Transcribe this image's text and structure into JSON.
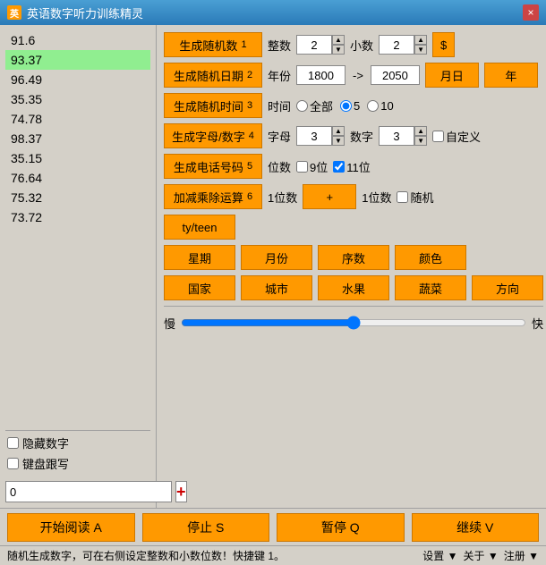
{
  "window": {
    "title": "英语数字听力训练精灵",
    "close_label": "×"
  },
  "number_list": {
    "items": [
      {
        "value": "91.6",
        "selected": false
      },
      {
        "value": "93.37",
        "selected": true
      },
      {
        "value": "96.49",
        "selected": false
      },
      {
        "value": "35.35",
        "selected": false
      },
      {
        "value": "74.78",
        "selected": false
      },
      {
        "value": "98.37",
        "selected": false
      },
      {
        "value": "35.15",
        "selected": false
      },
      {
        "value": "76.64",
        "selected": false
      },
      {
        "value": "75.32",
        "selected": false
      },
      {
        "value": "73.72",
        "selected": false
      }
    ],
    "hide_numbers_label": "隐藏数字",
    "keyboard_follow_label": "键盘跟写",
    "input_value": "0",
    "add_icon": "+"
  },
  "controls": {
    "row1": {
      "btn_label": "生成随机数",
      "btn_num": "1",
      "integer_label": "整数",
      "integer_value": "2",
      "decimal_label": "小数",
      "decimal_value": "2",
      "currency_label": "$"
    },
    "row2": {
      "btn_label": "生成随机日期",
      "btn_num": "2",
      "year_label": "年份",
      "year_from": "1800",
      "arrow": "->",
      "year_to": "2050",
      "month_label": "月日",
      "year_unit": "年"
    },
    "row3": {
      "btn_label": "生成随机时间",
      "btn_num": "3",
      "time_label": "时间",
      "radio_all": "全部",
      "radio_5": "5",
      "radio_10": "10"
    },
    "row4": {
      "btn_label": "生成字母/数字",
      "btn_num": "4",
      "letter_label": "字母",
      "letter_value": "3",
      "number_label": "数字",
      "number_value": "3",
      "custom_label": "自定义"
    },
    "row5": {
      "btn_label": "生成电话号码",
      "btn_num": "5",
      "digit_label": "位数",
      "opt9_label": "9位",
      "opt11_label": "11位",
      "opt11_checked": true
    },
    "row6": {
      "btn_label": "加减乘除运算",
      "btn_num": "6",
      "digit1_label": "1位数",
      "op_label": "+",
      "digit2_label": "1位数",
      "random_label": "随机"
    },
    "row7": {
      "btn_label": "ty/teen"
    },
    "row8": {
      "btn1": "星期",
      "btn2": "月份",
      "btn3": "序数",
      "btn4": "颜色"
    },
    "row9": {
      "btn1": "国家",
      "btn2": "城市",
      "btn3": "水果",
      "btn4": "蔬菜",
      "btn5": "方向"
    },
    "speed": {
      "slow_label": "慢",
      "fast_label": "快",
      "value": 50
    }
  },
  "toolbar": {
    "start_label": "开始阅读 A",
    "stop_label": "停止 S",
    "pause_label": "暂停 Q",
    "continue_label": "继续 V"
  },
  "statusbar": {
    "hint": "随机生成数字，可在右侧设定整数和小数位数！快捷键 1。",
    "settings_label": "设置",
    "about_label": "关于",
    "register_label": "注册",
    "sep": "▼"
  }
}
